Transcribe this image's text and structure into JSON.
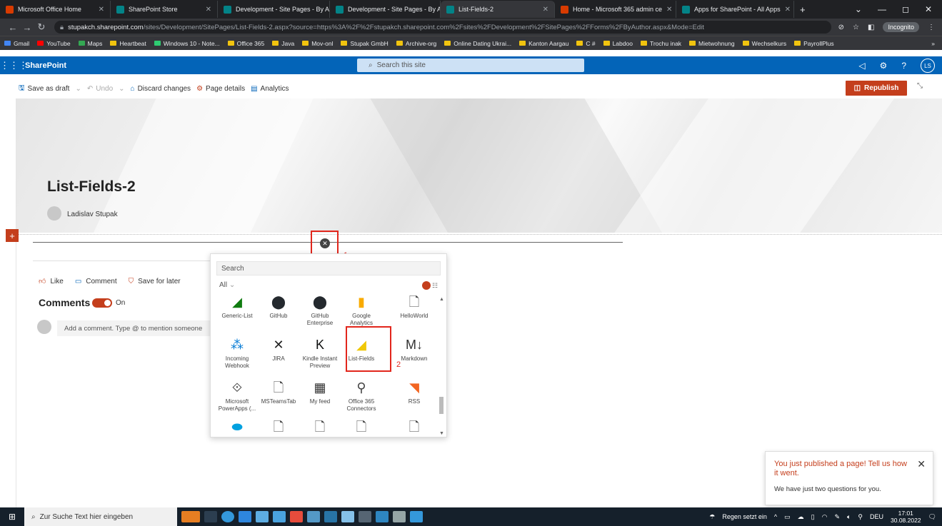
{
  "browser": {
    "tabs": [
      {
        "title": "Microsoft Office Home",
        "color": "#d83b01",
        "active": false
      },
      {
        "title": "SharePoint Store",
        "color": "#038387",
        "active": false
      },
      {
        "title": "Development - Site Pages - By A",
        "color": "#038387",
        "active": false
      },
      {
        "title": "Development - Site Pages - By A",
        "color": "#038387",
        "active": false
      },
      {
        "title": "List-Fields-2",
        "color": "#038387",
        "active": true
      },
      {
        "title": "Home - Microsoft 365 admin ce",
        "color": "#d83b01",
        "active": false
      },
      {
        "title": "Apps for SharePoint - All Apps",
        "color": "#038387",
        "active": false
      }
    ],
    "new_tab": "+",
    "window_controls": {
      "minimize": "—",
      "maximize": "◻",
      "close": "✕",
      "dropdown": "⌄"
    },
    "url_host": "stupakch.sharepoint.com",
    "url_path": "/sites/Development/SitePages/List-Fields-2.aspx?source=https%3A%2F%2Fstupakch.sharepoint.com%2Fsites%2FDevelopment%2FSitePages%2FForms%2FByAuthor.aspx&Mode=Edit",
    "incognito_label": "Incognito",
    "bookmarks": [
      {
        "label": "Gmail",
        "color": "#4285f4"
      },
      {
        "label": "YouTube",
        "color": "#ff0000"
      },
      {
        "label": "Maps",
        "color": "#34a853"
      },
      {
        "label": "Heartbeat",
        "color": "#f1c40f"
      },
      {
        "label": "Windows 10 - Note...",
        "color": "#2ecc71"
      },
      {
        "label": "Office 365",
        "color": "#f1c40f"
      },
      {
        "label": "Java",
        "color": "#f1c40f"
      },
      {
        "label": "Mov-onl",
        "color": "#f1c40f"
      },
      {
        "label": "Stupak GmbH",
        "color": "#f1c40f"
      },
      {
        "label": "Archive-org",
        "color": "#f1c40f"
      },
      {
        "label": "Online Dating Ukrai...",
        "color": "#f1c40f"
      },
      {
        "label": "Kanton Aargau",
        "color": "#f1c40f"
      },
      {
        "label": "C #",
        "color": "#f1c40f"
      },
      {
        "label": "Labdoo",
        "color": "#f1c40f"
      },
      {
        "label": "Trochu inak",
        "color": "#f1c40f"
      },
      {
        "label": "Mietwohnung",
        "color": "#f1c40f"
      },
      {
        "label": "Wechselkurs",
        "color": "#f1c40f"
      },
      {
        "label": "PayrollPlus",
        "color": "#f1c40f"
      }
    ],
    "bookmarks_more": "»"
  },
  "suite": {
    "app_name": "SharePoint",
    "search_placeholder": "Search this site",
    "avatar_initials": "LS"
  },
  "command_bar": {
    "save_as_draft": "Save as draft",
    "undo": "Undo",
    "discard": "Discard changes",
    "page_details": "Page details",
    "analytics": "Analytics",
    "republish": "Republish"
  },
  "page": {
    "title": "List-Fields-2",
    "author": "Ladislav Stupak"
  },
  "social": {
    "like": "Like",
    "comment": "Comment",
    "save_for_later": "Save for later",
    "comments_title": "Comments",
    "comments_toggle": "On",
    "comment_placeholder": "Add a comment. Type @ to mention someone"
  },
  "toolbox": {
    "search_placeholder": "Search",
    "filter": "All",
    "webparts": [
      {
        "label": "Generic-List",
        "icon": "◢",
        "color": "#107c10"
      },
      {
        "label": "GitHub",
        "icon": "⬤",
        "color": "#24292e"
      },
      {
        "label": "GitHub Enterprise",
        "icon": "⬤",
        "color": "#24292e"
      },
      {
        "label": "Google Analytics",
        "icon": "▮",
        "color": "#f9ab00"
      },
      {
        "label": "HelloWorld",
        "icon": "🗋",
        "color": "#444"
      },
      {
        "label": "Incoming Webhook",
        "icon": "⁂",
        "color": "#0078d4"
      },
      {
        "label": "JIRA",
        "icon": "✕",
        "color": "#222"
      },
      {
        "label": "Kindle Instant Preview",
        "icon": "K",
        "color": "#0f1111"
      },
      {
        "label": "List-Fields",
        "icon": "◢",
        "color": "#f0c808"
      },
      {
        "label": "Markdown",
        "icon": "M↓",
        "color": "#333"
      },
      {
        "label": "Microsoft PowerApps (...",
        "icon": "⟐",
        "color": "#444"
      },
      {
        "label": "MSTeamsTab",
        "icon": "🗋",
        "color": "#444"
      },
      {
        "label": "My feed",
        "icon": "▦",
        "color": "#333"
      },
      {
        "label": "Office 365 Connectors",
        "icon": "⚲",
        "color": "#444"
      },
      {
        "label": "RSS",
        "icon": "◥",
        "color": "#f26522"
      },
      {
        "label": "",
        "icon": "⬬",
        "color": "#00a1e0"
      },
      {
        "label": "",
        "icon": "🗋",
        "color": "#444"
      },
      {
        "label": "",
        "icon": "🗋",
        "color": "#444"
      },
      {
        "label": "",
        "icon": "🗋",
        "color": "#444"
      },
      {
        "label": "",
        "icon": "🗋",
        "color": "#444"
      }
    ]
  },
  "annotations": {
    "label1": "1",
    "label2": "2"
  },
  "toast": {
    "title": "You just published a page! Tell us how it went.",
    "body": "We have just two questions for you."
  },
  "taskbar": {
    "search_placeholder": "Zur Suche Text hier eingeben",
    "weather": "Regen setzt ein",
    "language": "DEU",
    "time": "17:01",
    "date": "30.08.2022"
  },
  "colors": {
    "brand": "#0364b8",
    "accent": "#c43e1c",
    "highlight": "#e2261c"
  }
}
